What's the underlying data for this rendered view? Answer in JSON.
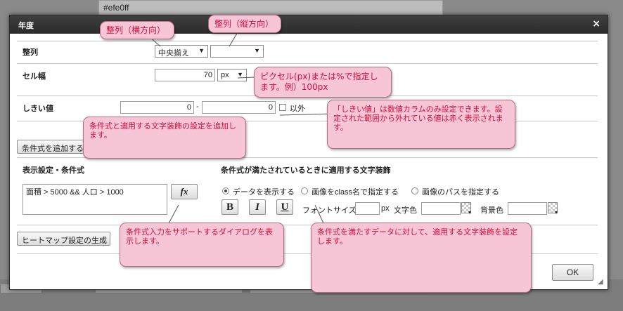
{
  "background": {
    "color_code": "#efe0ff"
  },
  "dialog": {
    "title": "年度",
    "close_symbol": "×"
  },
  "align": {
    "label": "整列",
    "horizontal_value": "中央揃え",
    "vertical_value": ""
  },
  "cell_width": {
    "label": "セル幅",
    "value": "70",
    "unit": "px"
  },
  "threshold": {
    "label": "しきい値",
    "min": "0",
    "separator": "-",
    "max": "0",
    "exclude_label": "以外"
  },
  "buttons": {
    "add_condition": "条件式を追加する",
    "fx": "fx",
    "generate_heatmap": "ヒートマップ設定の生成",
    "ok": "OK"
  },
  "condition_section": {
    "left_header": "表示設定・条件式",
    "right_header": "条件式が満たされているときに適用する文字装飾",
    "expression": "面積 > 5000 && 人口 > 1000"
  },
  "decoration": {
    "radio_options": [
      "データを表示する",
      "画像をclass名で指定する",
      "画像のパスを指定する"
    ],
    "selected_index": 0,
    "bold": "B",
    "italic": "I",
    "underline": "U",
    "font_size_label": "フォントサイズ",
    "font_size_unit": "px",
    "text_color_label": "文字色",
    "bg_color_label": "背景色"
  },
  "callouts": {
    "align_horizontal": "整列（横方向）",
    "align_vertical": "整列（縦方向）",
    "cell_width_unit": "ピクセル(px)または%で指定します。例）100px",
    "threshold_note": "「しきい値」は数値カラムのみ設定できます。設定された範囲から外れている値は赤く表示されます。",
    "add_condition_note": "条件式と適用する文字装飾の設定を追加します。",
    "fx_note": "条件式入力をサポートするダイアログを表示します。",
    "decoration_note": "条件式を満たすデータに対して、適用する文字装飾を設定します。"
  },
  "colors": {
    "callout_bg": "#f7c6d6",
    "callout_text": "#d10c3c",
    "titlebar": "#333333"
  }
}
